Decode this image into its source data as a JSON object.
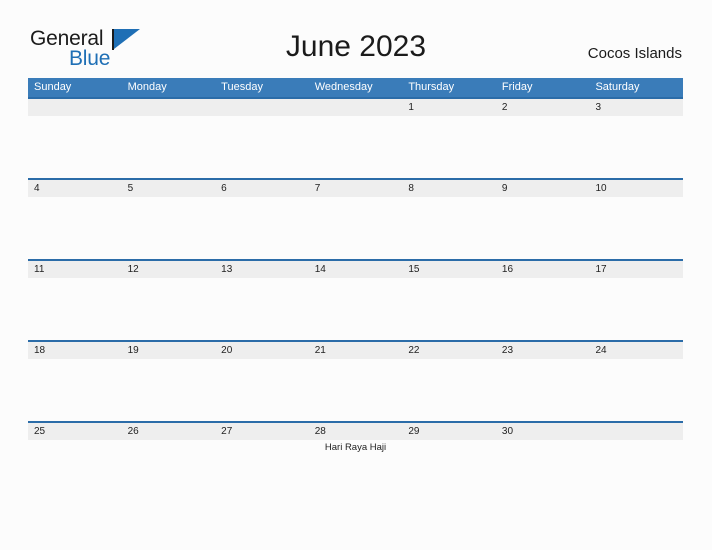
{
  "brand": {
    "name_part1": "General",
    "name_part2": "Blue",
    "flag_icon": "flag-triangle-icon"
  },
  "header": {
    "title": "June 2023",
    "region": "Cocos Islands"
  },
  "colors": {
    "header_blue": "#3a7cb9",
    "rule_blue": "#2b6ca8",
    "band_gray": "#eeeeee",
    "brand_blue": "#1f6fb5",
    "page_background": "#fcfcfc",
    "text": "#1b1b1b"
  },
  "calendar": {
    "month": "June",
    "year": "2023",
    "weekdays": [
      "Sunday",
      "Monday",
      "Tuesday",
      "Wednesday",
      "Thursday",
      "Friday",
      "Saturday"
    ],
    "weeks": [
      [
        {
          "day": ""
        },
        {
          "day": ""
        },
        {
          "day": ""
        },
        {
          "day": ""
        },
        {
          "day": "1",
          "events": []
        },
        {
          "day": "2",
          "events": []
        },
        {
          "day": "3",
          "events": []
        }
      ],
      [
        {
          "day": "4",
          "events": []
        },
        {
          "day": "5",
          "events": []
        },
        {
          "day": "6",
          "events": []
        },
        {
          "day": "7",
          "events": []
        },
        {
          "day": "8",
          "events": []
        },
        {
          "day": "9",
          "events": []
        },
        {
          "day": "10",
          "events": []
        }
      ],
      [
        {
          "day": "11",
          "events": []
        },
        {
          "day": "12",
          "events": []
        },
        {
          "day": "13",
          "events": []
        },
        {
          "day": "14",
          "events": []
        },
        {
          "day": "15",
          "events": []
        },
        {
          "day": "16",
          "events": []
        },
        {
          "day": "17",
          "events": []
        }
      ],
      [
        {
          "day": "18",
          "events": []
        },
        {
          "day": "19",
          "events": []
        },
        {
          "day": "20",
          "events": []
        },
        {
          "day": "21",
          "events": []
        },
        {
          "day": "22",
          "events": []
        },
        {
          "day": "23",
          "events": []
        },
        {
          "day": "24",
          "events": []
        }
      ],
      [
        {
          "day": "25",
          "events": []
        },
        {
          "day": "26",
          "events": []
        },
        {
          "day": "27",
          "events": []
        },
        {
          "day": "28",
          "events": [
            "Hari Raya Haji"
          ]
        },
        {
          "day": "29",
          "events": []
        },
        {
          "day": "30",
          "events": []
        },
        {
          "day": ""
        }
      ]
    ]
  }
}
